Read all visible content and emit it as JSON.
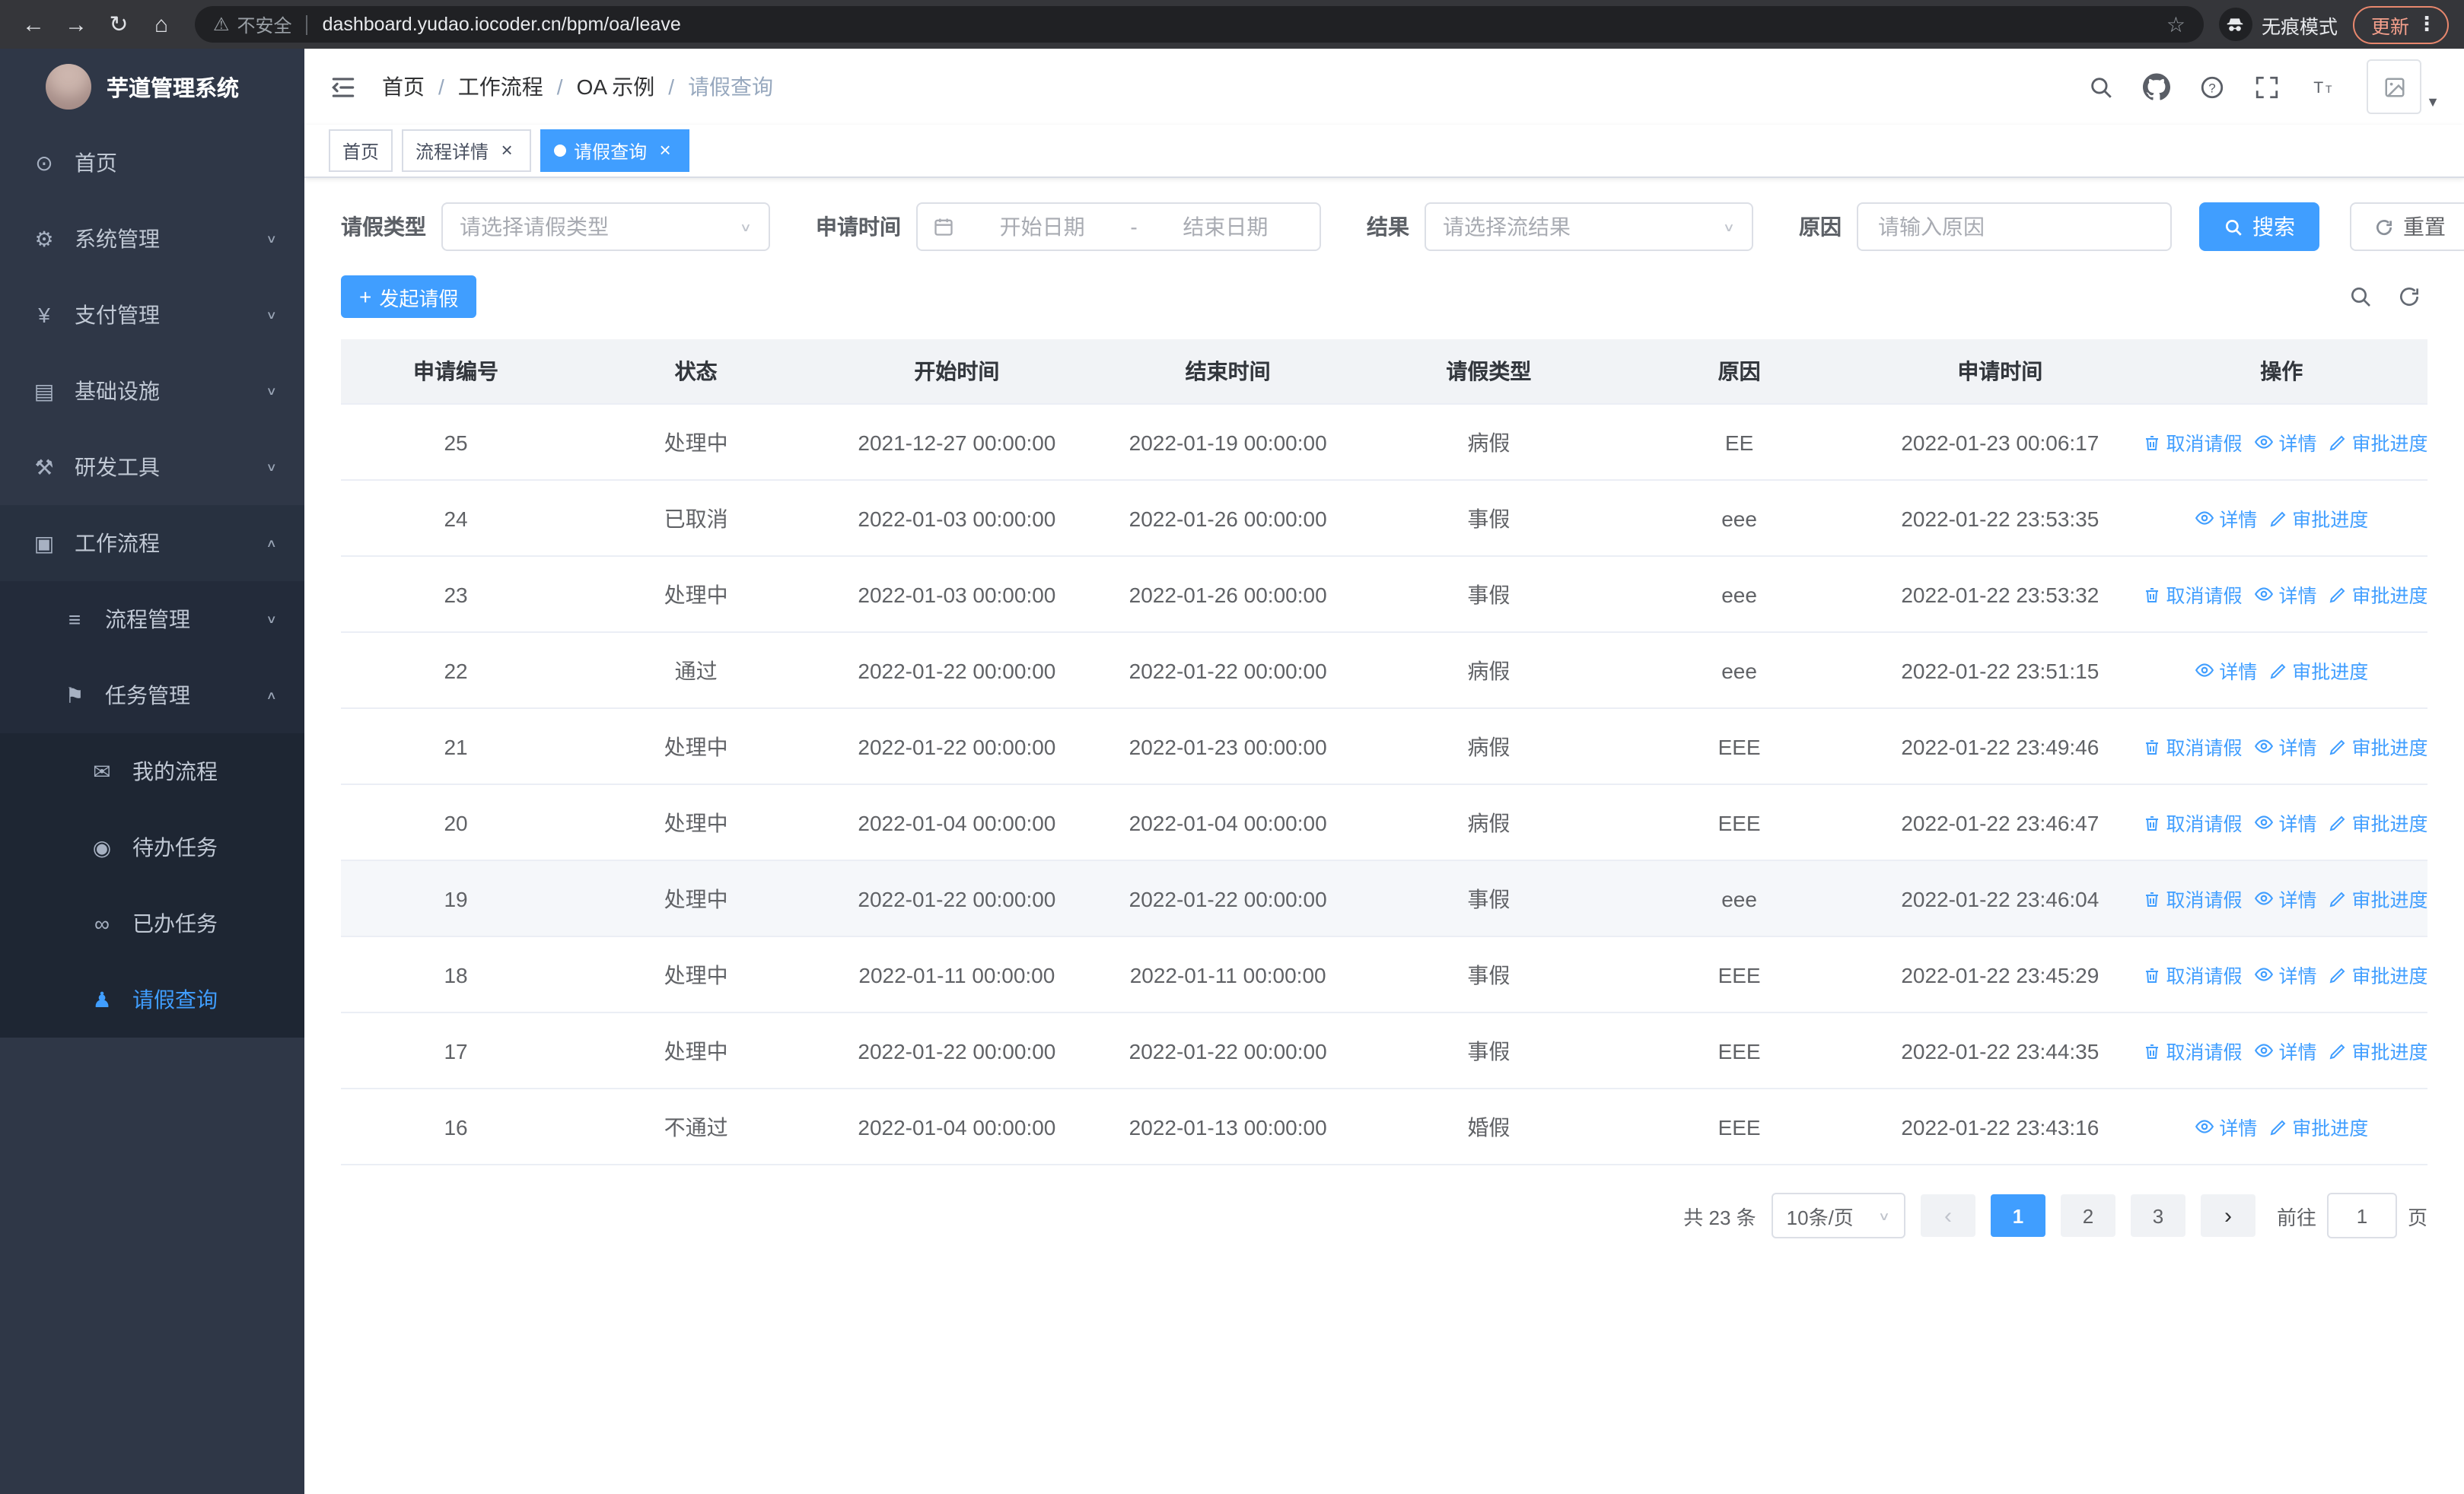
{
  "browser": {
    "security_label": "不安全",
    "url": "dashboard.yudao.iocoder.cn/bpm/oa/leave",
    "incognito_label": "无痕模式",
    "update_label": "更新"
  },
  "sidebar": {
    "logo_title": "芋道管理系统",
    "menu": [
      {
        "id": "home",
        "label": "首页",
        "icon": "dashboard-icon",
        "level": 1,
        "arrow": "",
        "active": false,
        "expanded": false
      },
      {
        "id": "system",
        "label": "系统管理",
        "icon": "gear-icon",
        "level": 1,
        "arrow": "down",
        "active": false,
        "expanded": false
      },
      {
        "id": "payment",
        "label": "支付管理",
        "icon": "yen-icon",
        "level": 1,
        "arrow": "down",
        "active": false,
        "expanded": false
      },
      {
        "id": "infrastructure",
        "label": "基础设施",
        "icon": "infra-icon",
        "level": 1,
        "arrow": "down",
        "active": false,
        "expanded": false
      },
      {
        "id": "dev-tools",
        "label": "研发工具",
        "icon": "tool-icon",
        "level": 1,
        "arrow": "down",
        "active": false,
        "expanded": false
      },
      {
        "id": "workflow",
        "label": "工作流程",
        "icon": "workflow-icon",
        "level": 1,
        "arrow": "up",
        "active": false,
        "expanded": true
      },
      {
        "id": "process-mgmt",
        "label": "流程管理",
        "icon": "process-icon",
        "level": 2,
        "arrow": "down",
        "active": false,
        "expanded": false
      },
      {
        "id": "task-mgmt",
        "label": "任务管理",
        "icon": "task-icon",
        "level": 2,
        "arrow": "up",
        "active": false,
        "expanded": true
      },
      {
        "id": "my-process",
        "label": "我的流程",
        "icon": "chat-icon",
        "level": 3,
        "arrow": "",
        "active": false,
        "expanded": false
      },
      {
        "id": "todo-task",
        "label": "待办任务",
        "icon": "eye-icon",
        "level": 3,
        "arrow": "",
        "active": false,
        "expanded": false
      },
      {
        "id": "done-task",
        "label": "已办任务",
        "icon": "glasses-icon",
        "level": 3,
        "arrow": "",
        "active": false,
        "expanded": false
      },
      {
        "id": "leave-query",
        "label": "请假查询",
        "icon": "user-icon",
        "level": 3,
        "arrow": "",
        "active": true,
        "expanded": false
      }
    ]
  },
  "icon_glyphs": {
    "dashboard-icon": "⊙",
    "gear-icon": "⚙",
    "yen-icon": "¥",
    "infra-icon": "▤",
    "tool-icon": "⚒",
    "workflow-icon": "▣",
    "process-icon": "≡",
    "task-icon": "⚑",
    "chat-icon": "✉",
    "eye-icon": "◉",
    "glasses-icon": "∞",
    "user-icon": "♟"
  },
  "header": {
    "breadcrumbs": [
      "首页",
      "工作流程",
      "OA 示例",
      "请假查询"
    ]
  },
  "tabs": [
    {
      "label": "首页",
      "active": false,
      "closable": false
    },
    {
      "label": "流程详情",
      "active": false,
      "closable": true
    },
    {
      "label": "请假查询",
      "active": true,
      "closable": true
    }
  ],
  "filters": {
    "leave_type_label": "请假类型",
    "leave_type_placeholder": "请选择请假类型",
    "apply_time_label": "申请时间",
    "start_date_placeholder": "开始日期",
    "range_separator": "-",
    "end_date_placeholder": "结束日期",
    "result_label": "结果",
    "result_placeholder": "请选择流结果",
    "reason_label": "原因",
    "reason_placeholder": "请输入原因",
    "search_label": "搜索",
    "reset_label": "重置"
  },
  "toolbar": {
    "create_label": "发起请假"
  },
  "table": {
    "columns": [
      "申请编号",
      "状态",
      "开始时间",
      "结束时间",
      "请假类型",
      "原因",
      "申请时间",
      "操作"
    ],
    "action_labels": {
      "cancel": "取消请假",
      "detail": "详情",
      "progress": "审批进度"
    },
    "rows": [
      {
        "id": "25",
        "status": "处理中",
        "start": "2021-12-27 00:00:00",
        "end": "2022-01-19 00:00:00",
        "type": "病假",
        "reason": "EE",
        "applied": "2022-01-23 00:06:17",
        "actions": [
          "cancel",
          "detail",
          "progress"
        ],
        "highlight": false
      },
      {
        "id": "24",
        "status": "已取消",
        "start": "2022-01-03 00:00:00",
        "end": "2022-01-26 00:00:00",
        "type": "事假",
        "reason": "eee",
        "applied": "2022-01-22 23:53:35",
        "actions": [
          "detail",
          "progress"
        ],
        "highlight": false
      },
      {
        "id": "23",
        "status": "处理中",
        "start": "2022-01-03 00:00:00",
        "end": "2022-01-26 00:00:00",
        "type": "事假",
        "reason": "eee",
        "applied": "2022-01-22 23:53:32",
        "actions": [
          "cancel",
          "detail",
          "progress"
        ],
        "highlight": false
      },
      {
        "id": "22",
        "status": "通过",
        "start": "2022-01-22 00:00:00",
        "end": "2022-01-22 00:00:00",
        "type": "病假",
        "reason": "eee",
        "applied": "2022-01-22 23:51:15",
        "actions": [
          "detail",
          "progress"
        ],
        "highlight": false
      },
      {
        "id": "21",
        "status": "处理中",
        "start": "2022-01-22 00:00:00",
        "end": "2022-01-23 00:00:00",
        "type": "病假",
        "reason": "EEE",
        "applied": "2022-01-22 23:49:46",
        "actions": [
          "cancel",
          "detail",
          "progress"
        ],
        "highlight": false
      },
      {
        "id": "20",
        "status": "处理中",
        "start": "2022-01-04 00:00:00",
        "end": "2022-01-04 00:00:00",
        "type": "病假",
        "reason": "EEE",
        "applied": "2022-01-22 23:46:47",
        "actions": [
          "cancel",
          "detail",
          "progress"
        ],
        "highlight": false
      },
      {
        "id": "19",
        "status": "处理中",
        "start": "2022-01-22 00:00:00",
        "end": "2022-01-22 00:00:00",
        "type": "事假",
        "reason": "eee",
        "applied": "2022-01-22 23:46:04",
        "actions": [
          "cancel",
          "detail",
          "progress"
        ],
        "highlight": true
      },
      {
        "id": "18",
        "status": "处理中",
        "start": "2022-01-11 00:00:00",
        "end": "2022-01-11 00:00:00",
        "type": "事假",
        "reason": "EEE",
        "applied": "2022-01-22 23:45:29",
        "actions": [
          "cancel",
          "detail",
          "progress"
        ],
        "highlight": false
      },
      {
        "id": "17",
        "status": "处理中",
        "start": "2022-01-22 00:00:00",
        "end": "2022-01-22 00:00:00",
        "type": "事假",
        "reason": "EEE",
        "applied": "2022-01-22 23:44:35",
        "actions": [
          "cancel",
          "detail",
          "progress"
        ],
        "highlight": false
      },
      {
        "id": "16",
        "status": "不通过",
        "start": "2022-01-04 00:00:00",
        "end": "2022-01-13 00:00:00",
        "type": "婚假",
        "reason": "EEE",
        "applied": "2022-01-22 23:43:16",
        "actions": [
          "detail",
          "progress"
        ],
        "highlight": false
      }
    ]
  },
  "pagination": {
    "total": "共 23 条",
    "page_size": "10条/页",
    "pages": [
      "1",
      "2",
      "3"
    ],
    "active_page": "1",
    "goto_label": "前往",
    "goto_value": "1",
    "goto_suffix": "页"
  }
}
